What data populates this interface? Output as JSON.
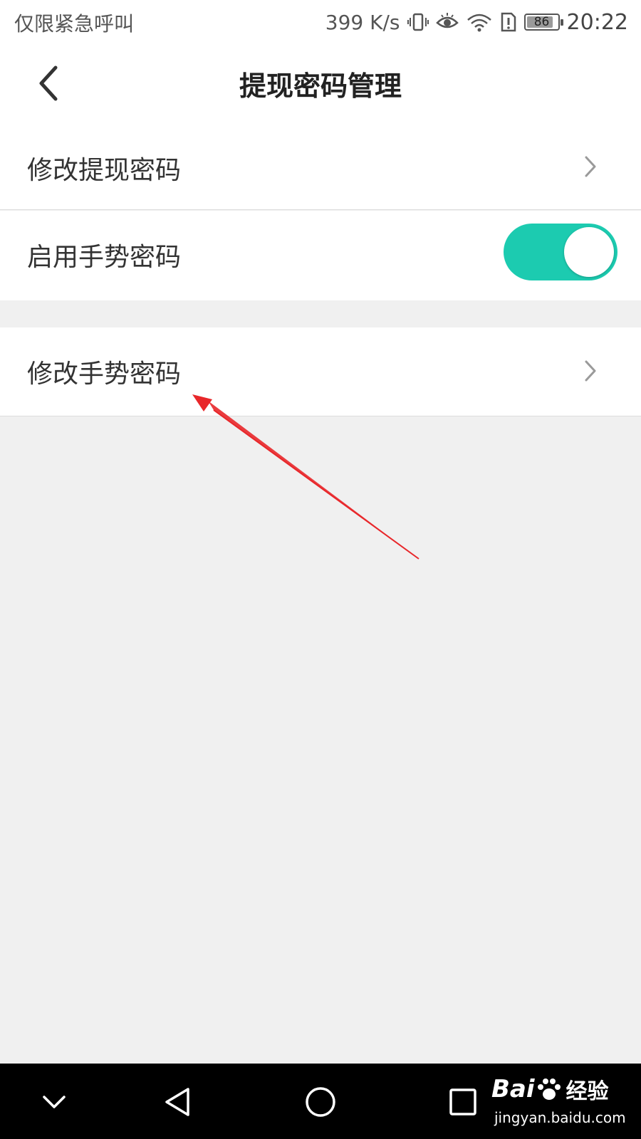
{
  "status_bar": {
    "left_text": "仅限紧急呼叫",
    "network_speed": "399 K/s",
    "battery_level": "86",
    "time": "20:22"
  },
  "header": {
    "title": "提现密码管理"
  },
  "list": {
    "items": [
      {
        "label": "修改提现密码",
        "action": "chevron"
      },
      {
        "label": "启用手势密码",
        "action": "toggle",
        "toggle_on": true
      },
      {
        "label": "修改手势密码",
        "action": "chevron"
      }
    ]
  },
  "colors": {
    "toggle_on": "#1ccbb0",
    "annotation_arrow": "#e8272a",
    "background": "#f0f0f0",
    "nav_bar": "#000000"
  },
  "icons": {
    "back": "chevron-left-icon",
    "row_arrow": "chevron-right-icon",
    "nav": [
      "chevron-down-icon",
      "triangle-back-icon",
      "circle-home-icon",
      "square-recent-icon"
    ]
  },
  "watermark": {
    "brand_prefix": "Bai",
    "brand_suffix": "经验",
    "url": "jingyan.baidu.com"
  }
}
